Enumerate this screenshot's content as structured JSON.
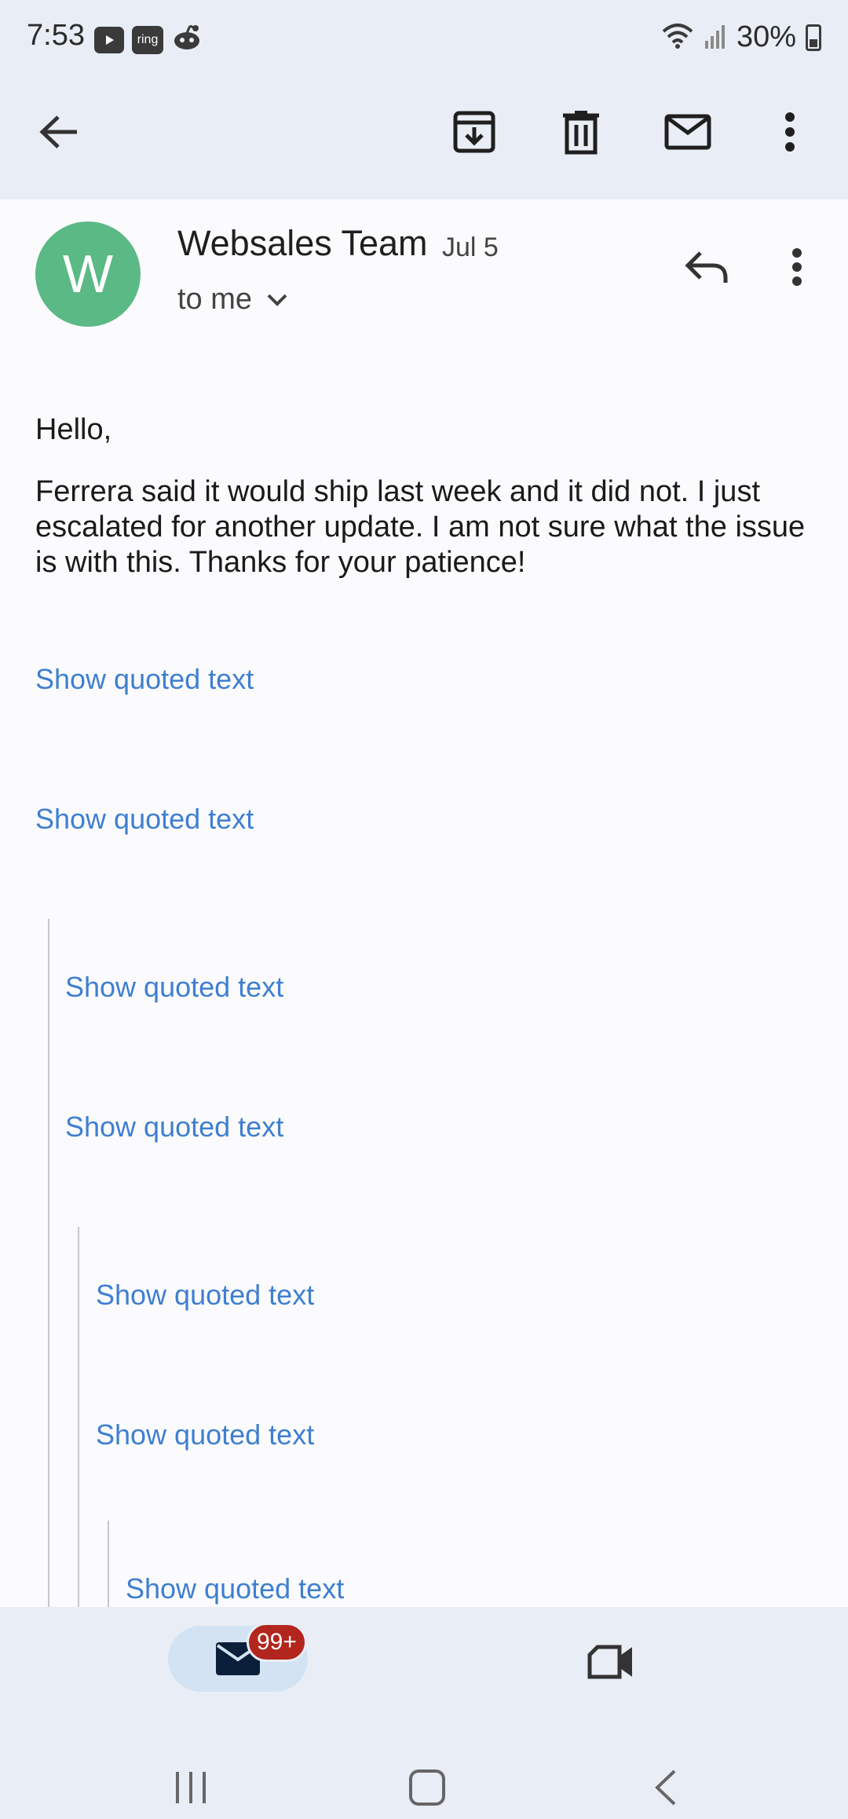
{
  "status_bar": {
    "time": "7:53",
    "ring_label": "ring",
    "battery": "30%"
  },
  "toolbar": {
    "back": "back-arrow-icon",
    "archive": "archive-icon",
    "delete": "delete-icon",
    "mark_unread": "mail-icon",
    "more": "more-vert-icon"
  },
  "message": {
    "avatar_letter": "W",
    "sender": "Websales Team",
    "date": "Jul 5",
    "recipient": "to me",
    "greeting": "Hello,",
    "body": "Ferrera said it would ship last week and it did not. I just escalated for another update. I am not sure what the issue is with this. Thanks for your patience!",
    "quoted": [
      "Show quoted text",
      "Show quoted text",
      "Show quoted text",
      "Show quoted text",
      "Show quoted text",
      "Show quoted text",
      "Show quoted text"
    ]
  },
  "bottom_nav": {
    "mail_badge": "99+"
  },
  "colors": {
    "accent_link": "#3f7fd0",
    "avatar": "#5bb985",
    "badge": "#b3261e",
    "chrome": "#e9eef6"
  }
}
